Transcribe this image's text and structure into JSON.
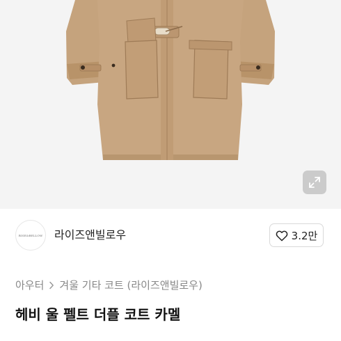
{
  "product_image": {
    "alt": "",
    "expand_icon": "expand-arrows-icon"
  },
  "brand": {
    "logo_text": "RISE&BELLOW",
    "name": "라이즈앤빌로우"
  },
  "like": {
    "icon": "heart-outline-icon",
    "count": "3.2만"
  },
  "breadcrumb": {
    "level1": "아우터",
    "separator_icon": "chevron-right-icon",
    "level2": "겨울 기타 코트 (라이즈앤빌로우)"
  },
  "product": {
    "title": "헤비 울 펠트 더플 코트 카멜"
  },
  "colors": {
    "coat": "#c6a47f",
    "coat_shadow": "#a9855f",
    "hero_bg": "#f4f4f4",
    "text_primary": "#111111",
    "text_secondary": "#888888",
    "border": "#d9d9d9"
  }
}
